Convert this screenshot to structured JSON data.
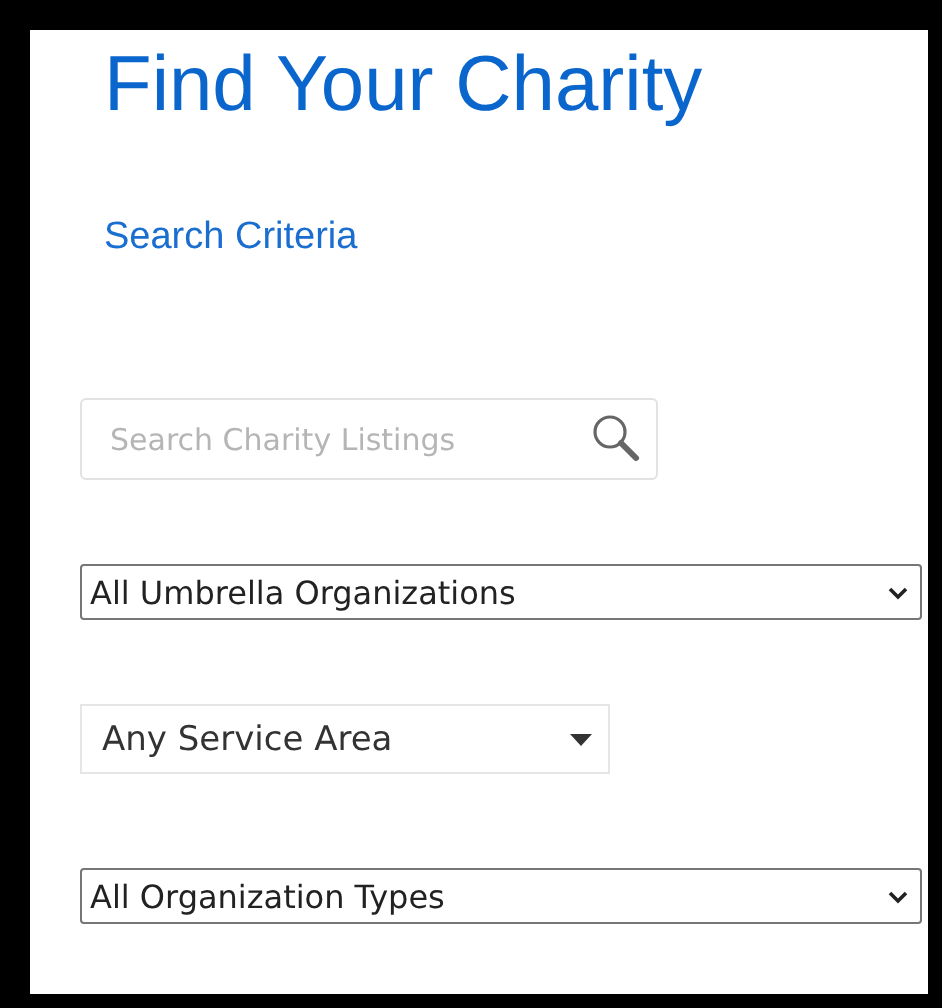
{
  "title": "Find Your Charity",
  "section_link": "Search Criteria",
  "search": {
    "placeholder": "Search Charity Listings"
  },
  "filters": [
    {
      "kind": "select",
      "value": "All Umbrella Organizations"
    },
    {
      "kind": "dropdown",
      "value": "Any Service Area"
    },
    {
      "kind": "select",
      "value": "All Organization Types"
    }
  ]
}
